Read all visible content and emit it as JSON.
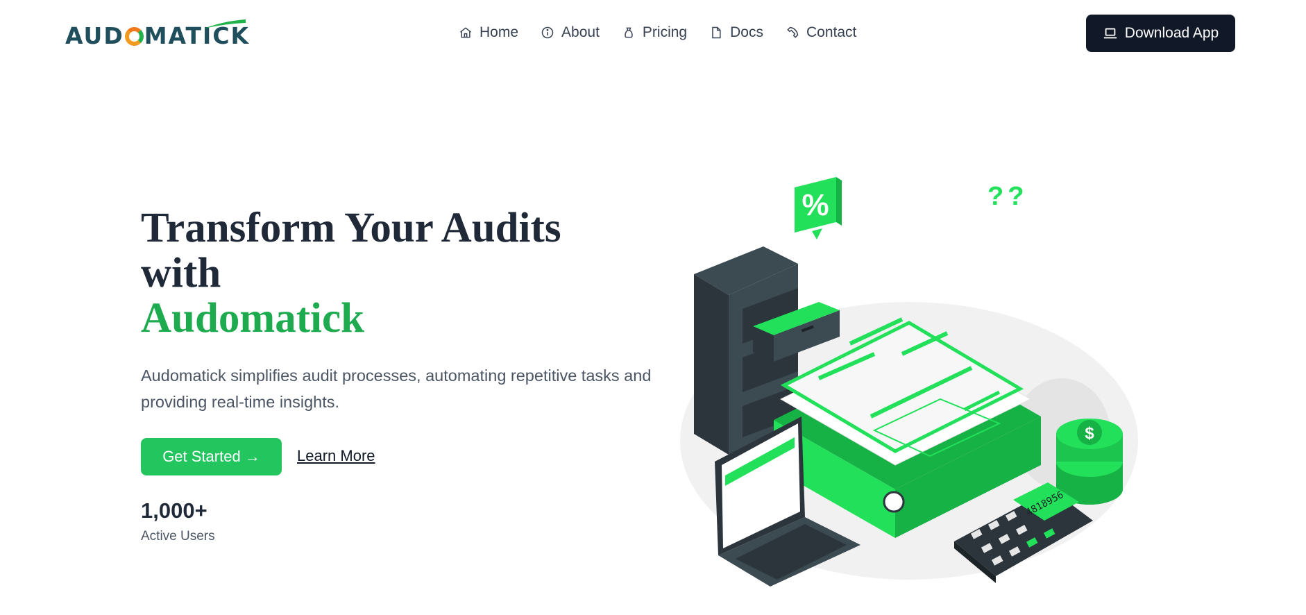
{
  "brand": {
    "logo_text": "AUDOMATICK",
    "colors": {
      "navy": "#1f4e5c",
      "green": "#1fb34a",
      "orange": "#f29a20"
    }
  },
  "nav": {
    "items": [
      {
        "label": "Home",
        "icon": "home-icon"
      },
      {
        "label": "About",
        "icon": "info-icon"
      },
      {
        "label": "Pricing",
        "icon": "money-bag-icon"
      },
      {
        "label": "Docs",
        "icon": "document-icon"
      },
      {
        "label": "Contact",
        "icon": "phone-icon"
      }
    ],
    "download_label": "Download App",
    "download_icon": "laptop-icon"
  },
  "hero": {
    "title_line1": "Transform Your Audits",
    "title_line2": "with",
    "title_accent": "Audomatick",
    "description": "Audomatick simplifies audit processes, automating repetitive tasks and providing real-time insights.",
    "cta_label": "Get Started →",
    "learn_more_label": "Learn More",
    "stat_value": "1,000+",
    "stat_label": "Active Users"
  },
  "illustration": {
    "percent_badge": "%",
    "question_marks": "??",
    "coin_symbol": "$",
    "calculator_display": "4818956"
  },
  "theme": {
    "accent": "#22c55e",
    "dark": "#111827",
    "title_green": "#1eab4f"
  }
}
